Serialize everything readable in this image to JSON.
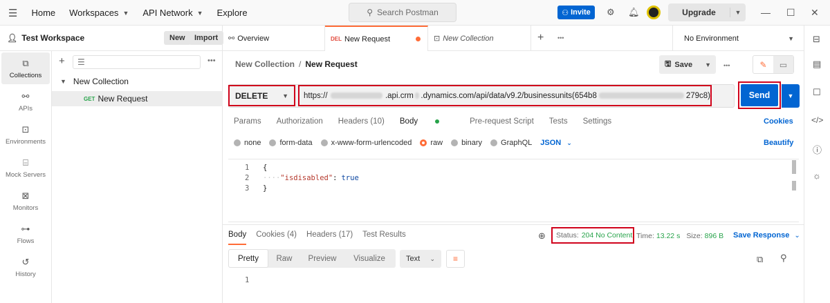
{
  "topnav": {
    "home": "Home",
    "workspaces": "Workspaces",
    "api_network": "API Network",
    "explore": "Explore",
    "search_placeholder": "Search Postman",
    "invite": "Invite",
    "upgrade": "Upgrade"
  },
  "workspace": {
    "name": "Test Workspace",
    "new_label": "New",
    "import_label": "Import"
  },
  "rail": [
    {
      "label": "Collections",
      "icon": "collections-icon"
    },
    {
      "label": "APIs",
      "icon": "apis-icon"
    },
    {
      "label": "Environments",
      "icon": "environments-icon"
    },
    {
      "label": "Mock Servers",
      "icon": "mock-servers-icon"
    },
    {
      "label": "Monitors",
      "icon": "monitors-icon"
    },
    {
      "label": "Flows",
      "icon": "flows-icon"
    },
    {
      "label": "History",
      "icon": "history-icon"
    }
  ],
  "tree": {
    "collection": "New Collection",
    "request_method": "GET",
    "request_name": "New Request"
  },
  "tabs": {
    "overview": "Overview",
    "active_method": "DEL",
    "active_name": "New Request",
    "collection": "New Collection",
    "environment": "No Environment"
  },
  "breadcrumb": {
    "parent": "New Collection",
    "separator": "/",
    "current": "New Request"
  },
  "request": {
    "save": "Save",
    "method": "DELETE",
    "url_start": "https://",
    "url_mid1": ".api.crm",
    "url_mid2": ".dynamics.com/api/data/v9.2/businessunits(654b8",
    "url_end": "279c8)",
    "send": "Send"
  },
  "req_tabs": {
    "params": "Params",
    "authorization": "Authorization",
    "headers": "Headers (10)",
    "body": "Body",
    "prerequest": "Pre-request Script",
    "tests": "Tests",
    "settings": "Settings",
    "cookies": "Cookies"
  },
  "body_opts": {
    "none": "none",
    "form_data": "form-data",
    "urlencoded": "x-www-form-urlencoded",
    "raw": "raw",
    "binary": "binary",
    "graphql": "GraphQL",
    "json": "JSON",
    "beautify": "Beautify"
  },
  "editor": {
    "lines": [
      "1",
      "2",
      "3"
    ],
    "line1": "{",
    "key": "\"isdisabled\"",
    "colon": ":",
    "value": "true",
    "line3": "}"
  },
  "response": {
    "tab_body": "Body",
    "tab_cookies": "Cookies (4)",
    "tab_headers": "Headers (17)",
    "tab_tests": "Test Results",
    "status_label": "Status:",
    "status_value": "204 No Content",
    "time_label": "Time:",
    "time_value": "13.22 s",
    "size_label": "Size:",
    "size_value": "896 B",
    "save_response": "Save Response",
    "view_pretty": "Pretty",
    "view_raw": "Raw",
    "view_preview": "Preview",
    "view_visualize": "Visualize",
    "format": "Text",
    "line1": "1"
  }
}
